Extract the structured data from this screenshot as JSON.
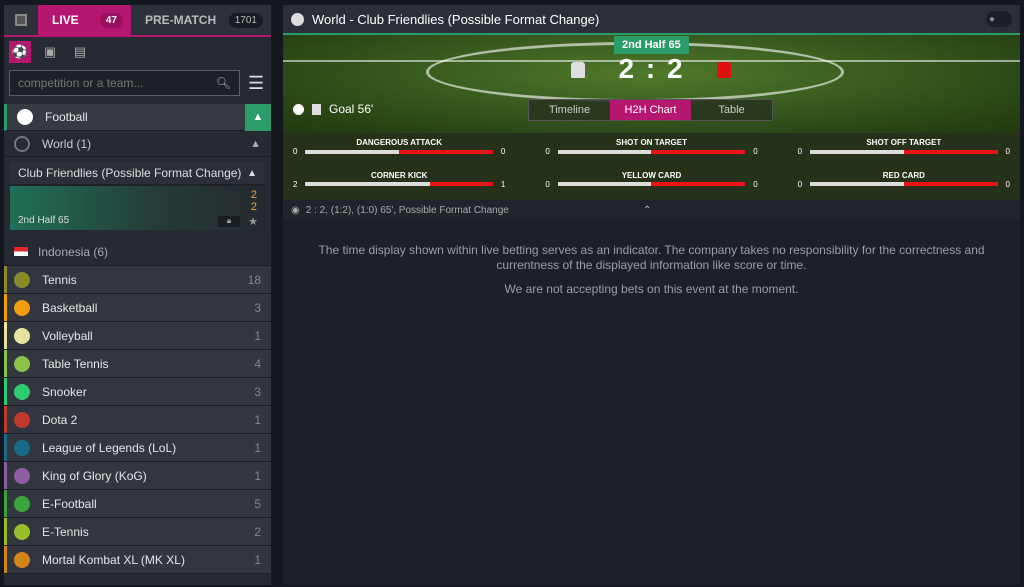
{
  "sidebar": {
    "tabs": {
      "live_label": "LIVE",
      "live_count": "47",
      "prematch_label": "PRE-MATCH",
      "prematch_count": "1701"
    },
    "search_placeholder": "competition or a team...",
    "football": {
      "label": "Football"
    },
    "region": {
      "label": "World (1)"
    },
    "competition": {
      "label": "Club Friendlies (Possible Format Change)",
      "match": {
        "time": "2nd Half  65",
        "home_score": "2",
        "away_score": "2"
      }
    },
    "region2": {
      "label": "Indonesia (6)"
    },
    "sports": [
      {
        "label": "Tennis",
        "count": "18",
        "color": "#8a8a2a"
      },
      {
        "label": "Basketball",
        "count": "3",
        "color": "#f39c12"
      },
      {
        "label": "Volleyball",
        "count": "1",
        "color": "#e8e4a0"
      },
      {
        "label": "Table Tennis",
        "count": "4",
        "color": "#8bc34a"
      },
      {
        "label": "Snooker",
        "count": "3",
        "color": "#2ecc71"
      },
      {
        "label": "Dota 2",
        "count": "1",
        "color": "#c0392b"
      },
      {
        "label": "League of Legends (LoL)",
        "count": "1",
        "color": "#1a6b8a"
      },
      {
        "label": "King of Glory (KoG)",
        "count": "1",
        "color": "#8e5ea2"
      },
      {
        "label": "E-Football",
        "count": "5",
        "color": "#3aa33a"
      },
      {
        "label": "E-Tennis",
        "count": "2",
        "color": "#9abf2a"
      },
      {
        "label": "Mortal Kombat XL (MK XL)",
        "count": "1",
        "color": "#d4831c"
      }
    ]
  },
  "main": {
    "title": "World - Club Friendlies (Possible Format Change)",
    "period": "2nd Half 65",
    "home_score": "2",
    "away_score": "2",
    "separator": ":",
    "event": "Goal 56'",
    "view_tabs": [
      "Timeline",
      "H2H Chart",
      "Table"
    ],
    "active_tab": "H2H Chart",
    "stats": [
      {
        "name": "DANGEROUS ATTACK",
        "home": "0",
        "away": "0",
        "home_share": 0.5
      },
      {
        "name": "SHOT ON TARGET",
        "home": "0",
        "away": "0",
        "home_share": 0.5
      },
      {
        "name": "SHOT OFF TARGET",
        "home": "0",
        "away": "0",
        "home_share": 0.5
      },
      {
        "name": "CORNER KICK",
        "home": "2",
        "away": "1",
        "home_share": 0.667
      },
      {
        "name": "YELLOW CARD",
        "home": "0",
        "away": "0",
        "home_share": 0.5
      },
      {
        "name": "RED CARD",
        "home": "0",
        "away": "0",
        "home_share": 0.5
      }
    ],
    "info": "2 : 2, (1:2), (1:0) 65', Possible Format Change",
    "disclaimer": "The time display shown within live betting serves as an indicator. The company takes no responsibility for the correctness and currentness of the displayed information like score or time.",
    "no_bets": "We are not accepting bets on this event at the moment."
  },
  "colors": {
    "accent": "#b5166f",
    "green": "#2c9c6a",
    "score": "#e6a93a"
  }
}
